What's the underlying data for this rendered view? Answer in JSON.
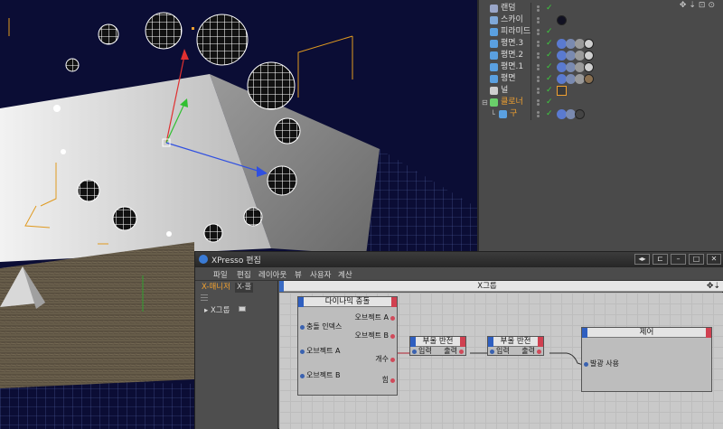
{
  "objects": [
    {
      "label": "랜덤",
      "icon_color": "#9aa6c8",
      "tag": ""
    },
    {
      "label": "스카이",
      "icon_color": "#7fa8d8",
      "tag": "#111122"
    },
    {
      "label": "피라미드",
      "icon_color": "#5aa0e0",
      "tag": ""
    },
    {
      "label": "평면.3",
      "icon_color": "#5aa0e0",
      "tag": "#cfcfcf"
    },
    {
      "label": "평면.2",
      "icon_color": "#5aa0e0",
      "tag": "#cfcfcf"
    },
    {
      "label": "평면.1",
      "icon_color": "#5aa0e0",
      "tag": "#cfcfcf"
    },
    {
      "label": "평면",
      "icon_color": "#5aa0e0",
      "tag": "#8a7050"
    },
    {
      "label": "널",
      "icon_color": "#cfcfcf",
      "tag": ""
    },
    {
      "label": "클로너",
      "icon_color": "#6ad06a",
      "tag": ""
    },
    {
      "label": "구",
      "icon_color": "#5aa0e0",
      "tag": "#444444"
    }
  ],
  "xpresso": {
    "title": "XPresso 편집",
    "menu": [
      "파일",
      "편집",
      "레이아웃",
      "뷰",
      "사용자",
      "계산"
    ],
    "tabs": {
      "active": "X-매니저",
      "inactive": "X-풀"
    },
    "left_item": "X그룹",
    "graph_title": "X그룹",
    "nodes": {
      "dynamics": {
        "title": "다이나믹 충돌",
        "inputs": [
          "충돌 인덱스",
          "오브젝트 A",
          "오브젝트 B"
        ],
        "outputs": [
          "오브젝트 A",
          "오브젝트 B",
          "개수",
          "힘"
        ]
      },
      "negate1": {
        "title": "부울 반전",
        "input": "입력",
        "output": "출력"
      },
      "negate2": {
        "title": "부울 반전",
        "input": "입력",
        "output": "출력"
      },
      "control": {
        "title": "제어",
        "input": "발광 사용"
      }
    }
  },
  "colors": {
    "accent": "#f0a030",
    "check": "#3ccf3c",
    "port_in": "#3a62b0",
    "port_out": "#d04a5a",
    "wire": "#b02030"
  }
}
